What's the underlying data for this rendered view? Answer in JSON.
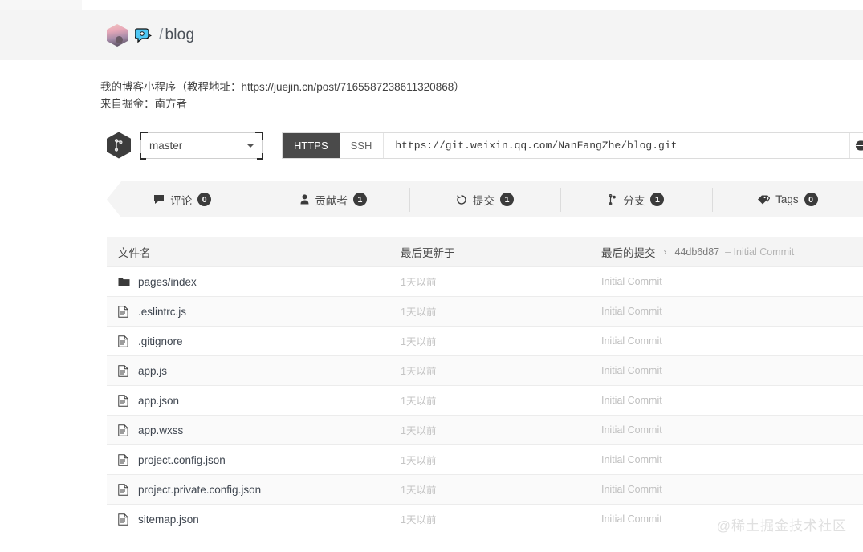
{
  "header": {
    "avatar_name": "user-avatar",
    "repo_emoji": "speech-bubble-emoji",
    "slash": "/",
    "repo_name": "blog"
  },
  "description": {
    "line1": "我的博客小程序（教程地址：https://juejin.cn/post/7165587238611320868）",
    "line2": "来自掘金：南方者"
  },
  "clone": {
    "branch_icon": "branch-icon",
    "branch_value": "master",
    "branch_options": [
      "master"
    ],
    "https_label": "HTTPS",
    "ssh_label": "SSH",
    "url": "https://git.weixin.qq.com/NanFangZhe/blog.git",
    "globe_icon": "globe-icon",
    "download_icon": "download-icon"
  },
  "stats": [
    {
      "icon": "comment-icon",
      "label": "评论",
      "count": "0"
    },
    {
      "icon": "contributor-icon",
      "label": "贡献者",
      "count": "1"
    },
    {
      "icon": "commit-history-icon",
      "label": "提交",
      "count": "1"
    },
    {
      "icon": "branch-icon",
      "label": "分支",
      "count": "1"
    },
    {
      "icon": "tag-icon",
      "label": "Tags",
      "count": "0"
    }
  ],
  "table": {
    "columns": {
      "name": "文件名",
      "updated": "最后更新于",
      "commit": "最后的提交",
      "chevron": "›",
      "commit_hash": "44db6d87",
      "commit_msg": "– Initial Commit"
    },
    "rows": [
      {
        "type": "folder",
        "name": "pages/index",
        "updated": "1天以前",
        "commit": "Initial Commit"
      },
      {
        "type": "file",
        "name": ".eslintrc.js",
        "updated": "1天以前",
        "commit": "Initial Commit"
      },
      {
        "type": "file",
        "name": ".gitignore",
        "updated": "1天以前",
        "commit": "Initial Commit"
      },
      {
        "type": "file",
        "name": "app.js",
        "updated": "1天以前",
        "commit": "Initial Commit"
      },
      {
        "type": "file",
        "name": "app.json",
        "updated": "1天以前",
        "commit": "Initial Commit"
      },
      {
        "type": "file",
        "name": "app.wxss",
        "updated": "1天以前",
        "commit": "Initial Commit"
      },
      {
        "type": "file",
        "name": "project.config.json",
        "updated": "1天以前",
        "commit": "Initial Commit"
      },
      {
        "type": "file",
        "name": "project.private.config.json",
        "updated": "1天以前",
        "commit": "Initial Commit"
      },
      {
        "type": "file",
        "name": "sitemap.json",
        "updated": "1天以前",
        "commit": "Initial Commit"
      }
    ]
  },
  "watermark": "@稀土掘金技术社区",
  "colors": {
    "band": "#f4f4f4",
    "accent_dark": "#4a4a4a",
    "badge": "#3b3b3b",
    "muted": "#c4c4c4"
  }
}
